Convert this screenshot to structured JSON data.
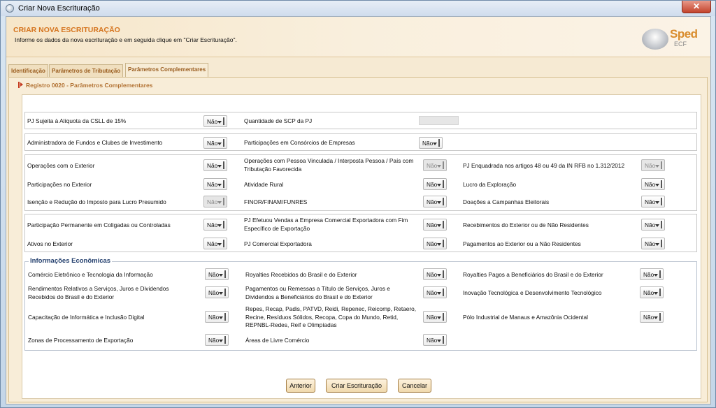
{
  "window": {
    "title": "Criar Nova Escrituração",
    "close_label": "✕"
  },
  "header": {
    "title": "CRIAR NOVA ESCRITURAÇÃO",
    "subtitle": "Informe os dados da nova escrituração e em seguida clique em \"Criar Escrituração\".",
    "logo_text": "Sped",
    "logo_sub": "ECF"
  },
  "tabs": [
    "Identificação",
    "Parâmetros de Tributação",
    "Parâmetros Complementares"
  ],
  "register_title": "Registro 0020 - Parâmetros Complementares",
  "rows": {
    "csll": {
      "label": "PJ Sujeita à Alíquota da CSLL de 15%",
      "value": "Não"
    },
    "qtd_scp": {
      "label": "Quantidade de SCP da PJ",
      "value": ""
    },
    "adm_fundos": {
      "label": "Administradora de Fundos e Clubes de Investimento",
      "value": "Não"
    },
    "consorcios": {
      "label": "Participações em Consórcios de Empresas",
      "value": "Não"
    },
    "op_exterior": {
      "label": "Operações com o Exterior",
      "value": "Não"
    },
    "op_vinculada": {
      "label": "Operações com Pessoa Vinculada / Interposta Pessoa / País com Tributação Favorecida",
      "value": "Não"
    },
    "pj_enquadrada": {
      "label": "PJ Enquadrada nos artigos 48 ou 49 da IN RFB no 1.312/2012",
      "value": "Não"
    },
    "part_exterior": {
      "label": "Participações no Exterior",
      "value": "Não"
    },
    "atividade_rural": {
      "label": "Atividade Rural",
      "value": "Não"
    },
    "lucro_exploracao": {
      "label": "Lucro da Exploração",
      "value": "Não"
    },
    "isencao": {
      "label": "Isenção e Redução do Imposto para Lucro Presumido",
      "value": "Não"
    },
    "finor": {
      "label": "FINOR/FINAM/FUNRES",
      "value": "Não"
    },
    "doacoes": {
      "label": "Doações a Campanhas Eleitorais",
      "value": "Não"
    },
    "part_permanente": {
      "label": "Participação Permanente em Coligadas ou Controladas",
      "value": "Não"
    },
    "vendas_exportadora": {
      "label": "PJ Efetuou Vendas a Empresa Comercial Exportadora com Fim Específico de Exportação",
      "value": "Não"
    },
    "receb_exterior": {
      "label": "Recebimentos do Exterior ou de Não Residentes",
      "value": "Não"
    },
    "ativos_exterior": {
      "label": "Ativos no Exterior",
      "value": "Não"
    },
    "comercial_exportadora": {
      "label": "PJ Comercial Exportadora",
      "value": "Não"
    },
    "pagto_exterior": {
      "label": "Pagamentos ao Exterior ou a Não Residentes",
      "value": "Não"
    }
  },
  "economic": {
    "legend": "Informações Econômicas",
    "comercio_eletronico": {
      "label": "Comércio Eletrônico e Tecnologia da Informação",
      "value": "Não"
    },
    "royalties_recebidos": {
      "label": "Royalties Recebidos do Brasil e do Exterior",
      "value": "Não"
    },
    "royalties_pagos": {
      "label": "Royalties Pagos a Beneficiários do Brasil e do Exterior",
      "value": "Não"
    },
    "rendimentos": {
      "label": "Rendimentos Relativos a Serviços, Juros e Dividendos Recebidos do Brasil e do Exterior",
      "value": "Não"
    },
    "pagamentos_remessas": {
      "label": "Pagamentos ou Remessas a Título de Serviços, Juros e Dividendos a Beneficiários do Brasil e do Exterior",
      "value": "Não"
    },
    "inovacao": {
      "label": "Inovação Tecnológica e Desenvolvimento Tecnológico",
      "value": "Não"
    },
    "capacitacao": {
      "label": "Capacitação de Informática e Inclusão Digital",
      "value": "Não"
    },
    "repes": {
      "label": "Repes, Recap, Padis, PATVD, Reidi, Repenec, Reicomp, Retaero, Recine, Resíduos Sólidos, Recopa, Copa do Mundo, Retid, REPNBL-Redes, Reif e Olimpíadas",
      "value": "Não"
    },
    "polo_manaus": {
      "label": "Pólo Industrial de Manaus e Amazônia Ocidental",
      "value": "Não"
    },
    "zonas_exportacao": {
      "label": "Zonas de Processamento de Exportação",
      "value": "Não"
    },
    "areas_livre": {
      "label": "Áreas de Livre Comércio",
      "value": "Não"
    }
  },
  "buttons": {
    "previous": "Anterior",
    "create": "Criar Escrituração",
    "cancel": "Cancelar"
  }
}
